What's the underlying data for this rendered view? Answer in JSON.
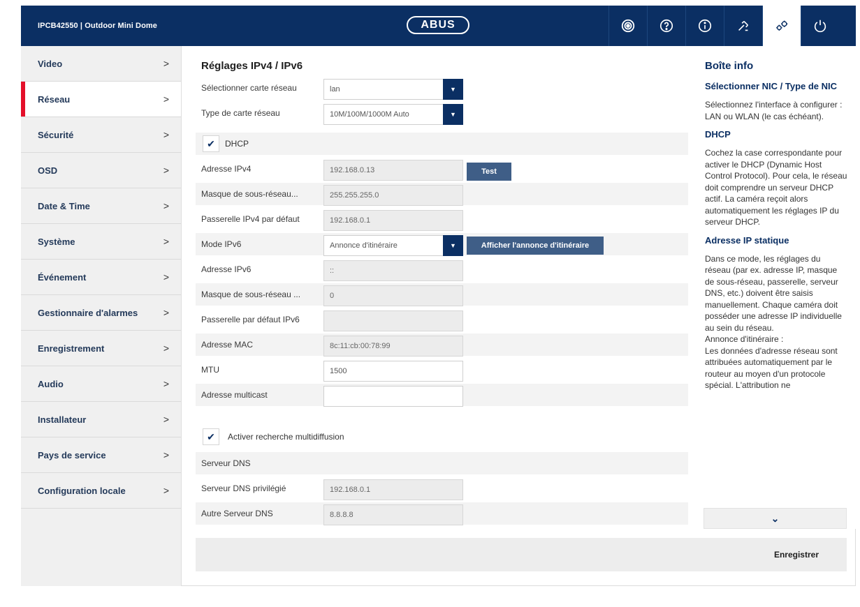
{
  "header": {
    "device_title": "IPCB42550  |  Outdoor Mini Dome",
    "logo_text": "ABUS",
    "icons": [
      "camera-icon",
      "help-icon",
      "info-icon",
      "tools-icon",
      "settings-icon",
      "power-icon"
    ],
    "colors": {
      "primary": "#0b2f63",
      "accent": "#e4102a"
    }
  },
  "sidebar": {
    "items": [
      {
        "label": "Video",
        "chevron": ">"
      },
      {
        "label": "Réseau",
        "chevron": ">"
      },
      {
        "label": "Sécurité",
        "chevron": ">"
      },
      {
        "label": "OSD",
        "chevron": ">"
      },
      {
        "label": "Date & Time",
        "chevron": ">"
      },
      {
        "label": "Système",
        "chevron": ">"
      },
      {
        "label": "Événement",
        "chevron": ">"
      },
      {
        "label": "Gestionnaire d'alarmes",
        "chevron": ">"
      },
      {
        "label": "Enregistrement",
        "chevron": ">"
      },
      {
        "label": "Audio",
        "chevron": ">"
      },
      {
        "label": "Installateur",
        "chevron": ">"
      },
      {
        "label": "Pays de service",
        "chevron": ">"
      },
      {
        "label": "Configuration locale",
        "chevron": ">"
      }
    ],
    "active_item": "Réseau"
  },
  "main": {
    "title": "Réglages IPv4 / IPv6",
    "nic_label": "Sélectionner carte réseau",
    "nic_value": "lan",
    "nic_type_label": "Type de carte réseau",
    "nic_type_value": "10M/100M/1000M Auto",
    "dhcp_label": "DHCP",
    "dhcp_checked": true,
    "ipv4_label": "Adresse IPv4",
    "ipv4_value": "192.168.0.13",
    "test_button": "Test",
    "mask_label": "Masque de sous-réseau...",
    "mask_value": "255.255.255.0",
    "gateway_label": "Passerelle IPv4 par défaut",
    "gateway_value": "192.168.0.1",
    "ipv6_mode_label": "Mode IPv6",
    "ipv6_mode_value": "Annonce d'itinéraire",
    "ipv6_announce_button": "Afficher l'annonce d'itinéraire",
    "ipv6_addr_label": "Adresse IPv6",
    "ipv6_addr_value": "::",
    "ipv6_mask_label": "Masque de sous-réseau ...",
    "ipv6_mask_value": "0",
    "ipv6_gateway_label": "Passerelle par défaut IPv6",
    "ipv6_gateway_value": "",
    "mac_label": "Adresse MAC",
    "mac_value": "8c:11:cb:00:78:99",
    "mtu_label": "MTU",
    "mtu_value": "1500",
    "multicast_label": "Adresse multicast",
    "multicast_value": "",
    "multicast_search_label": "Activer recherche multidiffusion",
    "multicast_search_checked": true,
    "dns_section_label": "Serveur DNS",
    "dns_pref_label": "Serveur DNS privilégié",
    "dns_pref_value": "192.168.0.1",
    "dns_alt_label": "Autre Serveur DNS",
    "dns_alt_value": "8.8.8.8"
  },
  "infobox": {
    "title": "Boîte info",
    "nic_heading": "Sélectionner NIC / Type de NIC",
    "nic_text": "Sélectionnez l'interface à configurer : LAN ou WLAN (le cas échéant).",
    "dhcp_heading": "DHCP",
    "dhcp_text": "Cochez la case correspondante pour activer le DHCP (Dynamic Host Control Protocol). Pour cela, le réseau doit comprendre un serveur DHCP actif. La caméra reçoit alors automatiquement les réglages IP du serveur DHCP.",
    "static_heading": "Adresse IP statique",
    "static_text": "Dans ce mode, les réglages du réseau (par ex. adresse IP, masque de sous-réseau, passerelle, serveur DNS, etc.) doivent être saisis manuellement. Chaque caméra doit posséder une adresse IP individuelle au sein du réseau.",
    "announce_label": "Annonce d'itinéraire :",
    "announce_text": "Les données d'adresse réseau sont attribuées automatiquement par le routeur au moyen d'un protocole spécial. L'attribution ne"
  },
  "footer": {
    "save_label": "Enregistrer"
  }
}
